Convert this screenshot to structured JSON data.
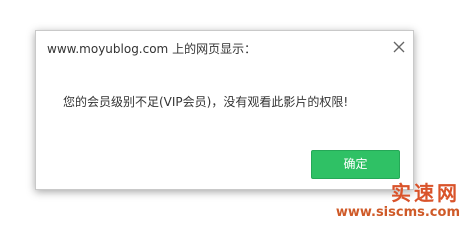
{
  "dialog": {
    "title": "www.moyublog.com 上的网页显示：",
    "message": "您的会员级别不足(VIP会员)，没有观看此影片的权限!",
    "ok_label": "确定",
    "close_icon": "close-icon",
    "accent_color": "#2fc165"
  },
  "watermark": {
    "name": "实速网",
    "url": "www.siscms.com"
  }
}
